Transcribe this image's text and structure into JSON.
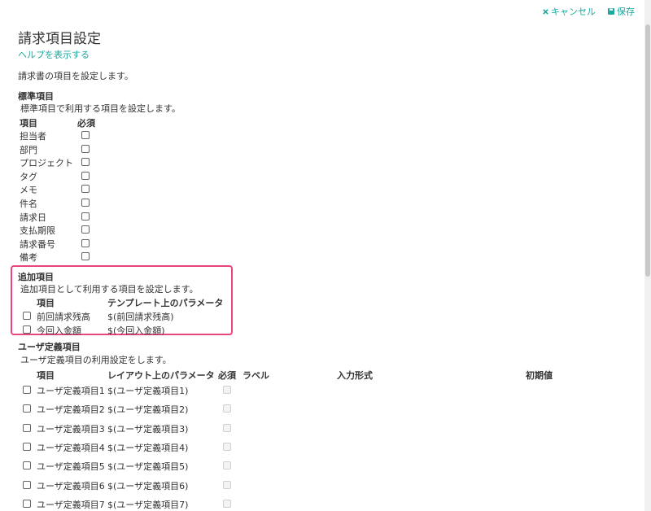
{
  "top_actions": {
    "cancel": "キャンセル",
    "save": "保存"
  },
  "page": {
    "title": "請求項目設定",
    "help_link": "ヘルプを表示する",
    "description": "請求書の項目を設定します。"
  },
  "standard": {
    "heading": "標準項目",
    "description": "標準項目で利用する項目を設定します。",
    "col_item": "項目",
    "col_required": "必須",
    "items": [
      "担当者",
      "部門",
      "プロジェクト",
      "タグ",
      "メモ",
      "件名",
      "請求日",
      "支払期限",
      "請求番号",
      "備考"
    ]
  },
  "additional": {
    "heading": "追加項目",
    "description": "追加項目として利用する項目を設定します。",
    "col_item": "項目",
    "col_param": "テンプレート上のパラメータ",
    "items": [
      {
        "label": "前回請求残高",
        "param": "$(前回請求残高)"
      },
      {
        "label": "今回入金額",
        "param": "$(今回入金額)"
      }
    ]
  },
  "user_defined": {
    "heading": "ユーザ定義項目",
    "description": "ユーザ定義項目の利用設定をします。",
    "col_item": "項目",
    "col_param": "レイアウト上のパラメータ",
    "col_required": "必須",
    "col_label": "ラベル",
    "col_input": "入力形式",
    "col_default": "初期値",
    "items": [
      {
        "label": "ユーザ定義項目1",
        "param": "$(ユーザ定義項目1)"
      },
      {
        "label": "ユーザ定義項目2",
        "param": "$(ユーザ定義項目2)"
      },
      {
        "label": "ユーザ定義項目3",
        "param": "$(ユーザ定義項目3)"
      },
      {
        "label": "ユーザ定義項目4",
        "param": "$(ユーザ定義項目4)"
      },
      {
        "label": "ユーザ定義項目5",
        "param": "$(ユーザ定義項目5)"
      },
      {
        "label": "ユーザ定義項目6",
        "param": "$(ユーザ定義項目6)"
      },
      {
        "label": "ユーザ定義項目7",
        "param": "$(ユーザ定義項目7)"
      }
    ]
  },
  "colors": {
    "accent": "#1aa8a0",
    "highlight": "#e8467c"
  }
}
